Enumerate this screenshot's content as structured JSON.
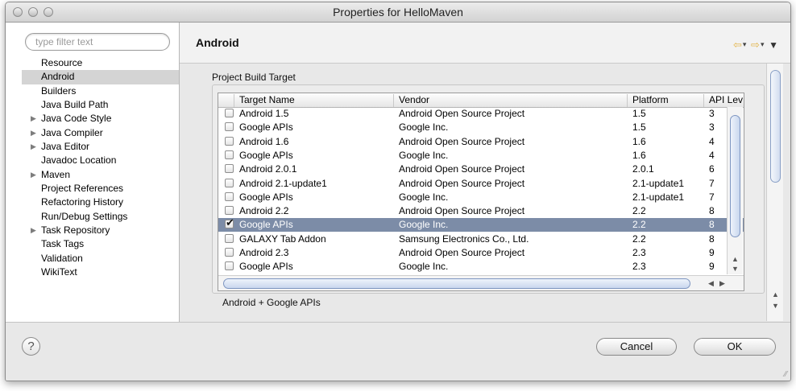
{
  "window": {
    "title": "Properties for HelloMaven"
  },
  "sidebar": {
    "filter_placeholder": "type filter text",
    "items": [
      {
        "label": "Resource",
        "expandable": false,
        "selected": false
      },
      {
        "label": "Android",
        "expandable": false,
        "selected": true
      },
      {
        "label": "Builders",
        "expandable": false,
        "selected": false
      },
      {
        "label": "Java Build Path",
        "expandable": false,
        "selected": false
      },
      {
        "label": "Java Code Style",
        "expandable": true,
        "selected": false
      },
      {
        "label": "Java Compiler",
        "expandable": true,
        "selected": false
      },
      {
        "label": "Java Editor",
        "expandable": true,
        "selected": false
      },
      {
        "label": "Javadoc Location",
        "expandable": false,
        "selected": false
      },
      {
        "label": "Maven",
        "expandable": true,
        "selected": false
      },
      {
        "label": "Project References",
        "expandable": false,
        "selected": false
      },
      {
        "label": "Refactoring History",
        "expandable": false,
        "selected": false
      },
      {
        "label": "Run/Debug Settings",
        "expandable": false,
        "selected": false
      },
      {
        "label": "Task Repository",
        "expandable": true,
        "selected": false
      },
      {
        "label": "Task Tags",
        "expandable": false,
        "selected": false
      },
      {
        "label": "Validation",
        "expandable": false,
        "selected": false
      },
      {
        "label": "WikiText",
        "expandable": false,
        "selected": false
      }
    ]
  },
  "page": {
    "title": "Android",
    "nav": {
      "back_icon": "back-arrow-icon",
      "forward_icon": "forward-arrow-icon",
      "menu_icon": "view-menu-icon"
    }
  },
  "build_target": {
    "group_label": "Project Build Target",
    "columns": [
      "Target Name",
      "Vendor",
      "Platform",
      "API Lev"
    ],
    "rows": [
      {
        "name": "Android 1.5",
        "vendor": "Android Open Source Project",
        "platform": "1.5",
        "api": "3",
        "checked": false,
        "selected": false
      },
      {
        "name": "Google APIs",
        "vendor": "Google Inc.",
        "platform": "1.5",
        "api": "3",
        "checked": false,
        "selected": false
      },
      {
        "name": "Android 1.6",
        "vendor": "Android Open Source Project",
        "platform": "1.6",
        "api": "4",
        "checked": false,
        "selected": false
      },
      {
        "name": "Google APIs",
        "vendor": "Google Inc.",
        "platform": "1.6",
        "api": "4",
        "checked": false,
        "selected": false
      },
      {
        "name": "Android 2.0.1",
        "vendor": "Android Open Source Project",
        "platform": "2.0.1",
        "api": "6",
        "checked": false,
        "selected": false
      },
      {
        "name": "Android 2.1-update1",
        "vendor": "Android Open Source Project",
        "platform": "2.1-update1",
        "api": "7",
        "checked": false,
        "selected": false
      },
      {
        "name": "Google APIs",
        "vendor": "Google Inc.",
        "platform": "2.1-update1",
        "api": "7",
        "checked": false,
        "selected": false
      },
      {
        "name": "Android 2.2",
        "vendor": "Android Open Source Project",
        "platform": "2.2",
        "api": "8",
        "checked": false,
        "selected": false
      },
      {
        "name": "Google APIs",
        "vendor": "Google Inc.",
        "platform": "2.2",
        "api": "8",
        "checked": true,
        "selected": true
      },
      {
        "name": "GALAXY Tab Addon",
        "vendor": "Samsung Electronics Co., Ltd.",
        "platform": "2.2",
        "api": "8",
        "checked": false,
        "selected": false
      },
      {
        "name": "Android 2.3",
        "vendor": "Android Open Source Project",
        "platform": "2.3",
        "api": "9",
        "checked": false,
        "selected": false
      },
      {
        "name": "Google APIs",
        "vendor": "Google Inc.",
        "platform": "2.3",
        "api": "9",
        "checked": false,
        "selected": false
      }
    ],
    "description": "Android + Google APIs"
  },
  "footer": {
    "help_label": "?",
    "cancel_label": "Cancel",
    "ok_label": "OK"
  }
}
